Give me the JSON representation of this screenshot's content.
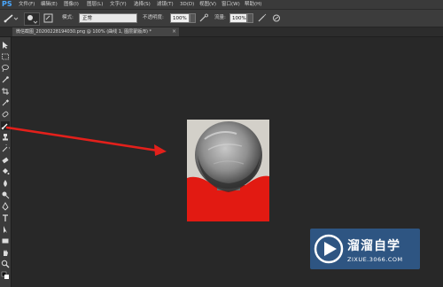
{
  "app": {
    "logo": "PS"
  },
  "menu": [
    "文件(F)",
    "编辑(E)",
    "图像(I)",
    "图层(L)",
    "文字(Y)",
    "选择(S)",
    "滤镜(T)",
    "3D(D)",
    "视图(V)",
    "窗口(W)",
    "帮助(H)"
  ],
  "options": {
    "mode_label": "模式:",
    "mode_value": "正常",
    "opacity_label": "不透明度:",
    "opacity_value": "100%",
    "flow_label": "流量:",
    "flow_value": "100%"
  },
  "document": {
    "tab_title": "微信截图_20200228194030.png @ 100% (曲线 1, 图层蒙版/8) *",
    "close": "×"
  },
  "watermark": {
    "title": "溜溜自学",
    "url": "ZIXUE.3066.COM"
  },
  "colors": {
    "accent_arrow": "#e3201b",
    "shirt_red": "#e21a12",
    "watermark_bg": "#2f5d92"
  }
}
